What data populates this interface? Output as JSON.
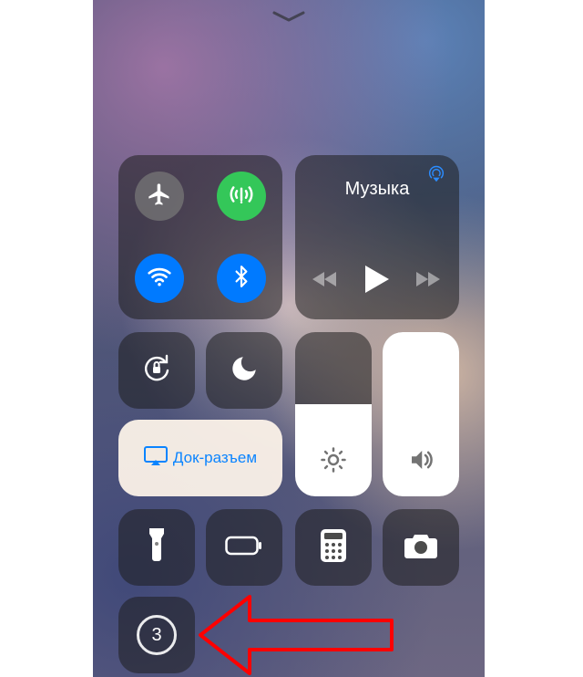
{
  "music": {
    "title": "Музыка"
  },
  "screen_mirroring": {
    "label": "Док-разъем"
  },
  "brightness": {
    "level_pct": 56
  },
  "volume": {
    "level_pct": 100
  },
  "screen_recording": {
    "countdown": "3"
  },
  "colors": {
    "accent_blue": "#007aff",
    "accent_green": "#34c759",
    "annotation_red": "#ff0000"
  },
  "icons": {
    "chevron_down": "chevron-down-icon",
    "airplane": "airplane-icon",
    "cellular": "cellular-icon",
    "wifi": "wifi-icon",
    "bluetooth": "bluetooth-icon",
    "airplay_audio": "airplay-audio-icon",
    "prev": "previous-track-icon",
    "play": "play-icon",
    "next": "next-track-icon",
    "rotation_lock": "rotation-lock-icon",
    "dnd": "do-not-disturb-icon",
    "screen_mirror": "screen-mirroring-icon",
    "brightness": "brightness-icon",
    "volume": "volume-icon",
    "flashlight": "flashlight-icon",
    "low_power": "low-power-icon",
    "calculator": "calculator-icon",
    "camera": "camera-icon"
  }
}
